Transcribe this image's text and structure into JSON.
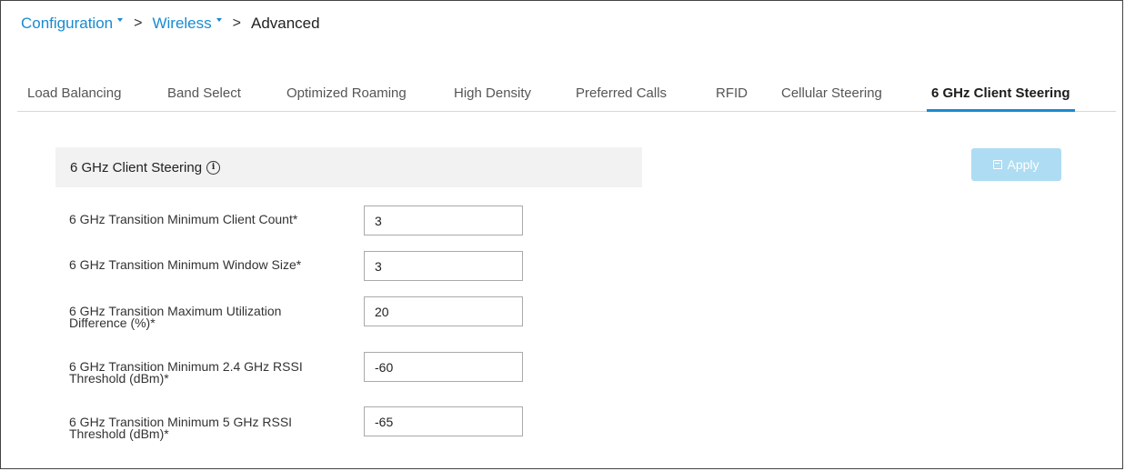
{
  "breadcrumb": {
    "items": [
      {
        "label": "Configuration",
        "dropdown": true
      },
      {
        "label": "Wireless",
        "dropdown": true
      },
      {
        "label": "Advanced",
        "dropdown": false
      }
    ],
    "separator": ">"
  },
  "tabs": [
    {
      "label": "Load Balancing",
      "active": false
    },
    {
      "label": "Band Select",
      "active": false
    },
    {
      "label": "Optimized Roaming",
      "active": false
    },
    {
      "label": "High Density",
      "active": false
    },
    {
      "label": "Preferred Calls",
      "active": false
    },
    {
      "label": "RFID",
      "active": false
    },
    {
      "label": "Cellular Steering",
      "active": false
    },
    {
      "label": "6 GHz Client Steering",
      "active": true
    }
  ],
  "section": {
    "title": "6 GHz Client Steering",
    "info_icon": "info-icon"
  },
  "apply_button": {
    "label": "Apply",
    "icon": "save-icon",
    "enabled": false
  },
  "fields": [
    {
      "label_lines": [
        "6 GHz Transition Minimum Client Count*"
      ],
      "value": "3"
    },
    {
      "label_lines": [
        "6 GHz Transition Minimum Window Size*"
      ],
      "value": "3"
    },
    {
      "label_lines": [
        "6 GHz Transition Maximum Utilization",
        "Difference (%)*"
      ],
      "value": "20"
    },
    {
      "label_lines": [
        "6 GHz Transition Minimum 2.4 GHz RSSI",
        "Threshold (dBm)*"
      ],
      "value": "-60"
    },
    {
      "label_lines": [
        "6 GHz Transition Minimum 5 GHz RSSI",
        "Threshold (dBm)*"
      ],
      "value": "-65"
    }
  ],
  "colors": {
    "accent": "#1a8ad1",
    "apply_disabled": "#aedcf2",
    "section_bg": "#f2f2f2"
  }
}
